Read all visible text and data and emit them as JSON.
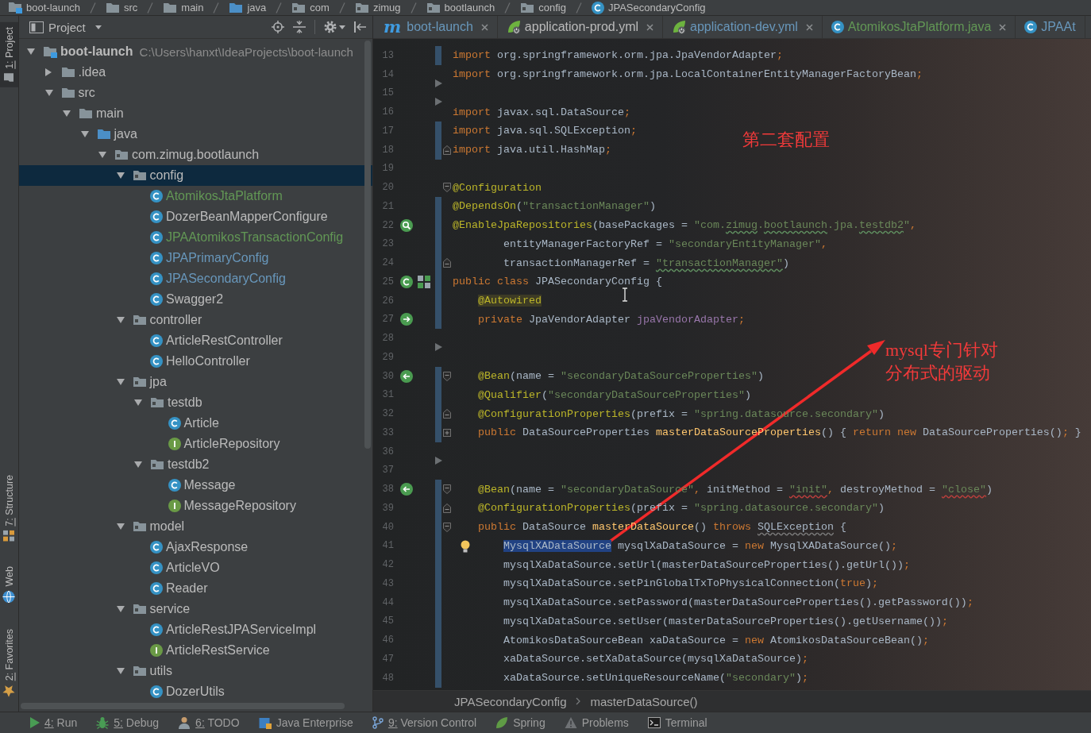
{
  "navigation_bar": [
    {
      "label": "boot-launch",
      "kind": "module"
    },
    {
      "label": "src",
      "kind": "folder"
    },
    {
      "label": "main",
      "kind": "folder"
    },
    {
      "label": "java",
      "kind": "source"
    },
    {
      "label": "com",
      "kind": "package"
    },
    {
      "label": "zimug",
      "kind": "package"
    },
    {
      "label": "bootlaunch",
      "kind": "package"
    },
    {
      "label": "config",
      "kind": "package"
    },
    {
      "label": "JPASecondaryConfig",
      "kind": "class"
    }
  ],
  "left_tool_strip": {
    "top": [
      {
        "label": "1: Project",
        "kind": "project",
        "selected": true,
        "mnemonic": true
      }
    ],
    "bottom": [
      {
        "label": "7: Structure",
        "kind": "structure",
        "selected": false,
        "mnemonic": true
      },
      {
        "label": "Web",
        "kind": "web",
        "selected": false,
        "mnemonic": false
      },
      {
        "label": "2: Favorites",
        "kind": "favorites",
        "selected": false,
        "mnemonic": true
      }
    ]
  },
  "project_panel": {
    "title": "Project",
    "tree": [
      {
        "label": "boot-launch",
        "path": "C:\\Users\\hanxt\\IdeaProjects\\boot-launch",
        "kind": "module",
        "expanded": true,
        "selected": false,
        "children": [
          {
            "label": ".idea",
            "kind": "folder",
            "expanded": false,
            "selected": false
          },
          {
            "label": "src",
            "kind": "folder",
            "expanded": true,
            "selected": false,
            "children": [
              {
                "label": "main",
                "kind": "folder",
                "expanded": true,
                "selected": false,
                "children": [
                  {
                    "label": "java",
                    "kind": "source",
                    "expanded": true,
                    "selected": false,
                    "children": [
                      {
                        "label": "com.zimug.bootlaunch",
                        "kind": "package",
                        "expanded": true,
                        "selected": false,
                        "children": [
                          {
                            "label": "config",
                            "kind": "package",
                            "expanded": true,
                            "selected": true,
                            "children": [
                              {
                                "label": "AtomikosJtaPlatform",
                                "kind": "class",
                                "color": "#629755",
                                "selected": false
                              },
                              {
                                "label": "DozerBeanMapperConfigure",
                                "kind": "class",
                                "color": "#bbbbbb",
                                "selected": false
                              },
                              {
                                "label": "JPAAtomikosTransactionConfig",
                                "kind": "class",
                                "color": "#629755",
                                "selected": false
                              },
                              {
                                "label": "JPAPrimaryConfig",
                                "kind": "class",
                                "color": "#6897bb",
                                "selected": false
                              },
                              {
                                "label": "JPASecondaryConfig",
                                "kind": "class",
                                "color": "#6897bb",
                                "selected": false
                              },
                              {
                                "label": "Swagger2",
                                "kind": "class",
                                "color": "#bbbbbb",
                                "selected": false
                              }
                            ]
                          },
                          {
                            "label": "controller",
                            "kind": "package",
                            "expanded": true,
                            "selected": false,
                            "children": [
                              {
                                "label": "ArticleRestController",
                                "kind": "class",
                                "color": "#bbbbbb",
                                "selected": false
                              },
                              {
                                "label": "HelloController",
                                "kind": "class",
                                "color": "#bbbbbb",
                                "selected": false
                              }
                            ]
                          },
                          {
                            "label": "jpa",
                            "kind": "package",
                            "expanded": true,
                            "selected": false,
                            "children": [
                              {
                                "label": "testdb",
                                "kind": "package",
                                "expanded": true,
                                "selected": false,
                                "children": [
                                  {
                                    "label": "Article",
                                    "kind": "class",
                                    "color": "#bbbbbb",
                                    "selected": false
                                  },
                                  {
                                    "label": "ArticleRepository",
                                    "kind": "interface",
                                    "color": "#bbbbbb",
                                    "selected": false
                                  }
                                ]
                              },
                              {
                                "label": "testdb2",
                                "kind": "package",
                                "expanded": true,
                                "selected": false,
                                "children": [
                                  {
                                    "label": "Message",
                                    "kind": "class",
                                    "color": "#bbbbbb",
                                    "selected": false
                                  },
                                  {
                                    "label": "MessageRepository",
                                    "kind": "interface",
                                    "color": "#bbbbbb",
                                    "selected": false
                                  }
                                ]
                              }
                            ]
                          },
                          {
                            "label": "model",
                            "kind": "package",
                            "expanded": true,
                            "selected": false,
                            "children": [
                              {
                                "label": "AjaxResponse",
                                "kind": "class",
                                "color": "#bbbbbb",
                                "selected": false
                              },
                              {
                                "label": "ArticleVO",
                                "kind": "class",
                                "color": "#bbbbbb",
                                "selected": false
                              },
                              {
                                "label": "Reader",
                                "kind": "class",
                                "color": "#bbbbbb",
                                "selected": false
                              }
                            ]
                          },
                          {
                            "label": "service",
                            "kind": "package",
                            "expanded": true,
                            "selected": false,
                            "children": [
                              {
                                "label": "ArticleRestJPAServiceImpl",
                                "kind": "class",
                                "color": "#bbbbbb",
                                "selected": false
                              },
                              {
                                "label": "ArticleRestService",
                                "kind": "interface",
                                "color": "#bbbbbb",
                                "selected": false
                              }
                            ]
                          },
                          {
                            "label": "utils",
                            "kind": "package",
                            "expanded": true,
                            "selected": false,
                            "children": [
                              {
                                "label": "DozerUtils",
                                "kind": "class",
                                "color": "#bbbbbb",
                                "selected": false
                              }
                            ]
                          }
                        ]
                      }
                    ]
                  }
                ]
              }
            ]
          }
        ]
      }
    ]
  },
  "editor": {
    "tabs": [
      {
        "label": "boot-launch",
        "kind": "maven",
        "icon_letter": "m",
        "color": "#6897bb",
        "selected": false,
        "close_button": true
      },
      {
        "label": "application-prod.yml",
        "kind": "spring",
        "color": "#bbbbbb",
        "selected": false,
        "close_button": true
      },
      {
        "label": "application-dev.yml",
        "kind": "spring",
        "color": "#6897bb",
        "selected": false,
        "close_button": true
      },
      {
        "label": "AtomikosJtaPlatform.java",
        "kind": "class",
        "color": "#629755",
        "selected": false,
        "close_button": true
      },
      {
        "label": "JPAAt",
        "kind": "class",
        "color": "#6897bb",
        "selected": false,
        "close_button": false
      }
    ],
    "lines": [
      {
        "number": "13",
        "marks": [
          {
            "kind": "modified"
          }
        ],
        "tokens": [
          {
            "kind": "keyword",
            "text": "import"
          },
          {
            "kind": "plain",
            "text": " org.springframework.orm.jpa.JpaVendorAdapter"
          },
          {
            "kind": "keyword",
            "text": ";"
          }
        ]
      },
      {
        "number": "14",
        "marks": [
          {
            "kind": "deleted"
          }
        ],
        "tokens": [
          {
            "kind": "keyword",
            "text": "import"
          },
          {
            "kind": "plain",
            "text": " org.springframework.orm.jpa.LocalContainerEntityManagerFactoryBean"
          },
          {
            "kind": "keyword",
            "text": ";"
          }
        ]
      },
      {
        "number": "15",
        "marks": [
          {
            "kind": "deleted"
          }
        ]
      },
      {
        "number": "16",
        "tokens": [
          {
            "kind": "keyword",
            "text": "import"
          },
          {
            "kind": "plain",
            "text": " javax.sql.DataSource"
          },
          {
            "kind": "keyword",
            "text": ";"
          }
        ]
      },
      {
        "number": "17",
        "marks": [
          {
            "kind": "modified"
          }
        ],
        "tokens": [
          {
            "kind": "keyword",
            "text": "import"
          },
          {
            "kind": "plain",
            "text": " java.sql.SQLException"
          },
          {
            "kind": "keyword",
            "text": ";"
          }
        ]
      },
      {
        "number": "18",
        "marks": [
          {
            "kind": "modified"
          },
          {
            "kind": "fold-end"
          }
        ],
        "tokens": [
          {
            "kind": "keyword",
            "text": "import"
          },
          {
            "kind": "plain",
            "text": " java.util.HashMap"
          },
          {
            "kind": "keyword",
            "text": ";"
          }
        ]
      },
      {
        "number": "19"
      },
      {
        "number": "20",
        "marks": [
          {
            "kind": "fold-start"
          }
        ],
        "tokens": [
          {
            "kind": "annotation",
            "text": "@Configuration"
          }
        ]
      },
      {
        "number": "21",
        "marks": [
          {
            "kind": "modified"
          }
        ],
        "tokens": [
          {
            "kind": "annotation",
            "text": "@DependsOn"
          },
          {
            "kind": "plain",
            "text": "("
          },
          {
            "kind": "string",
            "text": "\"transactionManager\""
          },
          {
            "kind": "plain",
            "text": ")"
          }
        ]
      },
      {
        "number": "22",
        "marks": [
          {
            "kind": "bean-search"
          },
          {
            "kind": "modified"
          }
        ],
        "tokens": [
          {
            "kind": "annotation",
            "text": "@EnableJpaRepositories"
          },
          {
            "kind": "plain",
            "text": "(basePackages = "
          },
          {
            "kind": "string",
            "text": "\"com."
          },
          {
            "kind": "typo",
            "text": "zimug"
          },
          {
            "kind": "string",
            "text": "."
          },
          {
            "kind": "typo",
            "text": "bootlaunch"
          },
          {
            "kind": "string",
            "text": ".jpa."
          },
          {
            "kind": "typo",
            "text": "testdb2"
          },
          {
            "kind": "string",
            "text": "\""
          },
          {
            "kind": "keyword",
            "text": ","
          }
        ]
      },
      {
        "number": "23",
        "marks": [
          {
            "kind": "modified"
          }
        ],
        "tokens": [
          {
            "kind": "plain",
            "text": "        entityManagerFactoryRef = "
          },
          {
            "kind": "string",
            "text": "\"secondaryEntityManager\""
          },
          {
            "kind": "keyword",
            "text": ","
          }
        ]
      },
      {
        "number": "24",
        "marks": [
          {
            "kind": "modified"
          },
          {
            "kind": "fold-end"
          }
        ],
        "tokens": [
          {
            "kind": "plain",
            "text": "        transactionManagerRef = "
          },
          {
            "kind": "typo",
            "text": "\"transactionManager\""
          },
          {
            "kind": "plain",
            "text": ")"
          }
        ]
      },
      {
        "number": "25",
        "marks": [
          {
            "kind": "bean-class"
          },
          {
            "kind": "modified"
          }
        ],
        "tokens": [
          {
            "kind": "keyword",
            "text": "public class"
          },
          {
            "kind": "plain",
            "text": " JPASecondaryConfig {"
          }
        ]
      },
      {
        "number": "26",
        "marks": [
          {
            "kind": "modified"
          }
        ],
        "tokens": [
          {
            "kind": "flagged",
            "text": "    @Autowired"
          }
        ]
      },
      {
        "number": "27",
        "marks": [
          {
            "kind": "injection"
          },
          {
            "kind": "modified"
          }
        ],
        "tokens": [
          {
            "kind": "keyword",
            "text": "    private"
          },
          {
            "kind": "plain",
            "text": " JpaVendorAdapter "
          },
          {
            "kind": "field",
            "text": "jpaVendorAdapter"
          },
          {
            "kind": "keyword",
            "text": ";"
          }
        ]
      },
      {
        "number": "28",
        "marks": [
          {
            "kind": "deleted"
          }
        ]
      },
      {
        "number": "29"
      },
      {
        "number": "30",
        "marks": [
          {
            "kind": "bean-method"
          },
          {
            "kind": "modified"
          },
          {
            "kind": "fold-start"
          }
        ],
        "tokens": [
          {
            "kind": "annotation",
            "text": "    @Bean"
          },
          {
            "kind": "plain",
            "text": "(name = "
          },
          {
            "kind": "string",
            "text": "\"secondaryDataSourceProperties\""
          },
          {
            "kind": "plain",
            "text": ")"
          }
        ]
      },
      {
        "number": "31",
        "marks": [
          {
            "kind": "modified"
          }
        ],
        "tokens": [
          {
            "kind": "annotation",
            "text": "    @Qualifier"
          },
          {
            "kind": "plain",
            "text": "("
          },
          {
            "kind": "string",
            "text": "\"secondaryDataSourceProperties\""
          },
          {
            "kind": "plain",
            "text": ")"
          }
        ]
      },
      {
        "number": "32",
        "marks": [
          {
            "kind": "modified"
          },
          {
            "kind": "fold-end"
          }
        ],
        "tokens": [
          {
            "kind": "annotation",
            "text": "    @ConfigurationProperties"
          },
          {
            "kind": "plain",
            "text": "(prefix = "
          },
          {
            "kind": "string",
            "text": "\"spring.datasource.secondary\""
          },
          {
            "kind": "plain",
            "text": ")"
          }
        ]
      },
      {
        "number": "33",
        "marks": [
          {
            "kind": "modified"
          },
          {
            "kind": "folded"
          }
        ],
        "tokens": [
          {
            "kind": "keyword",
            "text": "    public"
          },
          {
            "kind": "plain",
            "text": " DataSourceProperties "
          },
          {
            "kind": "method",
            "text": "masterDataSourceProperties"
          },
          {
            "kind": "plain",
            "text": "() { "
          },
          {
            "kind": "keyword",
            "text": "return new"
          },
          {
            "kind": "plain",
            "text": " DataSourceProperties()"
          },
          {
            "kind": "keyword",
            "text": ";"
          },
          {
            "kind": "plain",
            "text": " }"
          }
        ]
      },
      {
        "number": "36",
        "marks": [
          {
            "kind": "deleted"
          }
        ]
      },
      {
        "number": "37"
      },
      {
        "number": "38",
        "marks": [
          {
            "kind": "bean-method"
          },
          {
            "kind": "modified"
          },
          {
            "kind": "fold-start"
          }
        ],
        "tokens": [
          {
            "kind": "annotation",
            "text": "    @Bean"
          },
          {
            "kind": "plain",
            "text": "(name = "
          },
          {
            "kind": "string",
            "text": "\"secondaryDataSource\""
          },
          {
            "kind": "keyword",
            "text": ","
          },
          {
            "kind": "plain",
            "text": " initMethod = "
          },
          {
            "kind": "error",
            "text": "\"init\""
          },
          {
            "kind": "keyword",
            "text": ","
          },
          {
            "kind": "plain",
            "text": " destroyMethod = "
          },
          {
            "kind": "error",
            "text": "\"close\""
          },
          {
            "kind": "plain",
            "text": ")"
          }
        ]
      },
      {
        "number": "39",
        "marks": [
          {
            "kind": "modified"
          },
          {
            "kind": "fold-end"
          }
        ],
        "tokens": [
          {
            "kind": "annotation",
            "text": "    @ConfigurationProperties"
          },
          {
            "kind": "plain",
            "text": "(prefix = "
          },
          {
            "kind": "string",
            "text": "\"spring.datasource.secondary\""
          },
          {
            "kind": "plain",
            "text": ")"
          }
        ]
      },
      {
        "number": "40",
        "marks": [
          {
            "kind": "modified"
          },
          {
            "kind": "fold-start"
          }
        ],
        "tokens": [
          {
            "kind": "keyword",
            "text": "    public"
          },
          {
            "kind": "plain",
            "text": " DataSource "
          },
          {
            "kind": "method",
            "text": "masterDataSource"
          },
          {
            "kind": "plain",
            "text": "() "
          },
          {
            "kind": "keyword",
            "text": "throws "
          },
          {
            "kind": "unused",
            "text": "SQLException"
          },
          {
            "kind": "plain",
            "text": " {"
          }
        ]
      },
      {
        "number": "41",
        "marks": [
          {
            "kind": "modified"
          },
          {
            "kind": "intention"
          }
        ],
        "tokens": [
          {
            "kind": "selection",
            "text": "        MysqlXADataSource"
          },
          {
            "kind": "plain",
            "text": " mysqlXaDataSource = "
          },
          {
            "kind": "keyword",
            "text": "new"
          },
          {
            "kind": "plain",
            "text": " MysqlXADataSource()"
          },
          {
            "kind": "keyword",
            "text": ";"
          }
        ]
      },
      {
        "number": "42",
        "marks": [
          {
            "kind": "modified"
          }
        ],
        "tokens": [
          {
            "kind": "plain",
            "text": "        mysqlXaDataSource.setUrl(masterDataSourceProperties().getUrl())"
          },
          {
            "kind": "keyword",
            "text": ";"
          }
        ]
      },
      {
        "number": "43",
        "marks": [
          {
            "kind": "modified"
          }
        ],
        "tokens": [
          {
            "kind": "plain",
            "text": "        mysqlXaDataSource.setPinGlobalTxToPhysicalConnection("
          },
          {
            "kind": "keyword",
            "text": "true"
          },
          {
            "kind": "plain",
            "text": ")"
          },
          {
            "kind": "keyword",
            "text": ";"
          }
        ]
      },
      {
        "number": "44",
        "marks": [
          {
            "kind": "modified"
          }
        ],
        "tokens": [
          {
            "kind": "plain",
            "text": "        mysqlXaDataSource.setPassword(masterDataSourceProperties().getPassword())"
          },
          {
            "kind": "keyword",
            "text": ";"
          }
        ]
      },
      {
        "number": "45",
        "marks": [
          {
            "kind": "modified"
          }
        ],
        "tokens": [
          {
            "kind": "plain",
            "text": "        mysqlXaDataSource.setUser(masterDataSourceProperties().getUsername())"
          },
          {
            "kind": "keyword",
            "text": ";"
          }
        ]
      },
      {
        "number": "46",
        "marks": [
          {
            "kind": "modified"
          }
        ],
        "tokens": [
          {
            "kind": "plain",
            "text": "        AtomikosDataSourceBean xaDataSource = "
          },
          {
            "kind": "keyword",
            "text": "new"
          },
          {
            "kind": "plain",
            "text": " AtomikosDataSourceBean()"
          },
          {
            "kind": "keyword",
            "text": ";"
          }
        ]
      },
      {
        "number": "47",
        "marks": [
          {
            "kind": "modified"
          }
        ],
        "tokens": [
          {
            "kind": "plain",
            "text": "        xaDataSource.setXaDataSource(mysqlXaDataSource)"
          },
          {
            "kind": "keyword",
            "text": ";"
          }
        ]
      },
      {
        "number": "48",
        "marks": [
          {
            "kind": "modified"
          }
        ],
        "tokens": [
          {
            "kind": "plain",
            "text": "        xaDataSource.setUniqueResourceName("
          },
          {
            "kind": "string",
            "text": "\"secondary\""
          },
          {
            "kind": "plain",
            "text": ")"
          },
          {
            "kind": "keyword",
            "text": ";"
          }
        ]
      }
    ],
    "breadcrumb": [
      "JPASecondaryConfig",
      "masterDataSource()"
    ],
    "annotations": [
      "第二套配置",
      "mysql专门针对",
      "分布式的驱动"
    ]
  },
  "tool_window_bar": [
    {
      "label": "4: Run",
      "kind": "run",
      "mnemonic": true,
      "selected": false
    },
    {
      "label": "5: Debug",
      "kind": "debug",
      "mnemonic": true,
      "selected": false
    },
    {
      "label": "6: TODO",
      "kind": "todo",
      "mnemonic": true,
      "selected": false
    },
    {
      "label": "Java Enterprise",
      "kind": "enterprise",
      "mnemonic": false,
      "selected": false
    },
    {
      "label": "9: Version Control",
      "kind": "vcs",
      "mnemonic": true,
      "selected": false
    },
    {
      "label": "Spring",
      "kind": "spring",
      "mnemonic": false,
      "selected": false
    },
    {
      "label": "Problems",
      "kind": "problems",
      "mnemonic": false,
      "selected": false
    },
    {
      "label": "Terminal",
      "kind": "terminal",
      "mnemonic": false,
      "selected": false
    }
  ]
}
